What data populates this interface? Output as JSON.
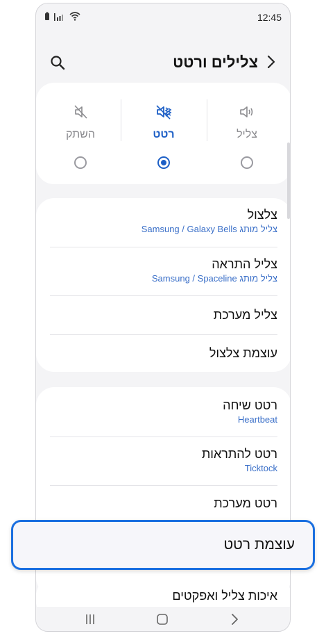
{
  "status_bar": {
    "time": "12:45"
  },
  "header": {
    "title": "צלילים ורטט"
  },
  "modes": [
    {
      "label": "צליל",
      "icon": "speaker-icon",
      "selected": false
    },
    {
      "label": "רטט",
      "icon": "vibrate-icon",
      "selected": true
    },
    {
      "label": "השתק",
      "icon": "mute-icon",
      "selected": false
    }
  ],
  "sound_group": [
    {
      "title": "צלצול",
      "subtitle": "צליל מותג Samsung / Galaxy Bells"
    },
    {
      "title": "צליל התראה",
      "subtitle": "צליל מותג Samsung / Spaceline"
    },
    {
      "title": "צליל מערכת"
    },
    {
      "title": "עוצמת צלצול"
    }
  ],
  "vibration_group": [
    {
      "title": "רטט שיחה",
      "subtitle": "Heartbeat"
    },
    {
      "title": "רטט להתראות",
      "subtitle": "Ticktock"
    },
    {
      "title": "רטט מערכת"
    }
  ],
  "highlighted": {
    "title": "עוצמת רטט"
  },
  "bottom_item": {
    "title": "איכות צליל ואפקטים"
  },
  "colors": {
    "accent": "#1d5fc6",
    "highlight_border": "#1a6fe0",
    "subtitle": "#3a6fc8"
  }
}
